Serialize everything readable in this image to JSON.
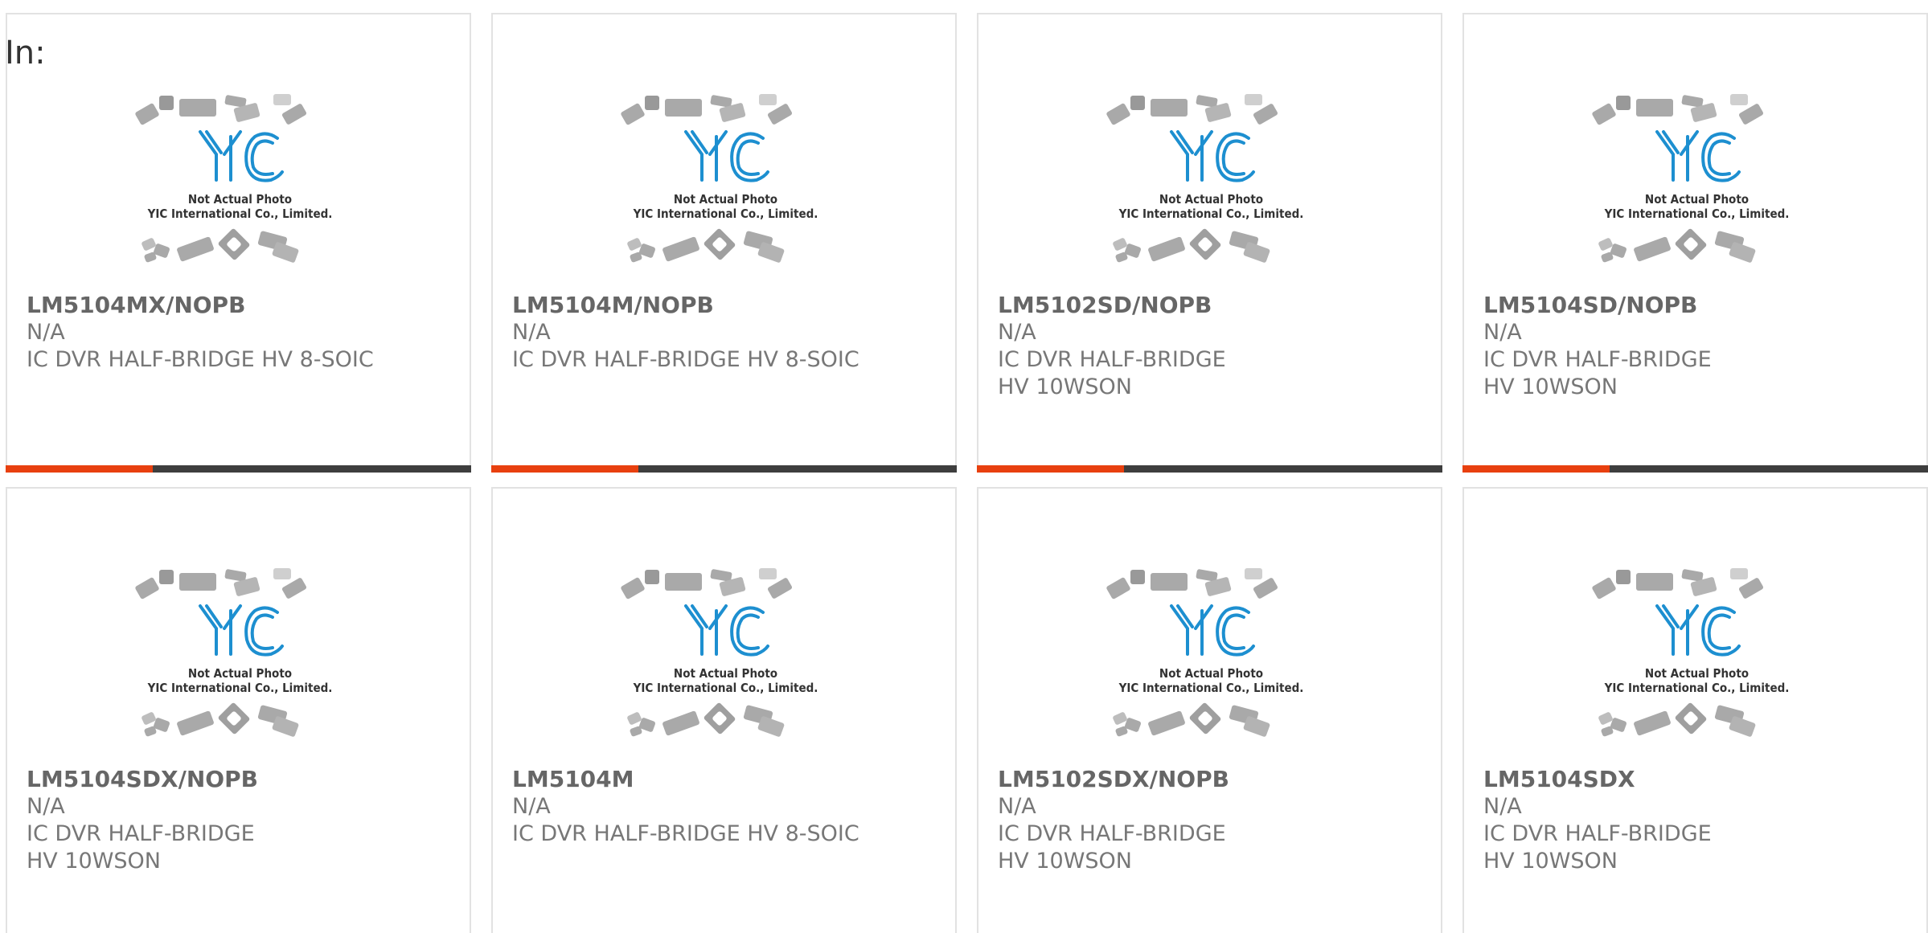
{
  "header": {
    "label": "In:"
  },
  "colors": {
    "accent": "#e8400f",
    "bar": "#3e3e3e",
    "logo": "#1d8fd0"
  },
  "thumbnail": {
    "line1": "Not Actual Photo",
    "line2": "YIC International Co., Limited.",
    "logo_text": "YIC"
  },
  "products": [
    {
      "part": "LM5104MX/NOPB",
      "manufacturer": "N/A",
      "description": "IC DVR HALF-BRIDGE HV 8-SOIC"
    },
    {
      "part": "LM5104M/NOPB",
      "manufacturer": "N/A",
      "description": "IC DVR HALF-BRIDGE HV 8-SOIC"
    },
    {
      "part": "LM5102SD/NOPB",
      "manufacturer": "N/A",
      "description": "IC DVR HALF-BRIDGE HV 10WSON"
    },
    {
      "part": "LM5104SD/NOPB",
      "manufacturer": "N/A",
      "description": "IC DVR HALF-BRIDGE HV 10WSON"
    },
    {
      "part": "LM5104SDX/NOPB",
      "manufacturer": "N/A",
      "description": "IC DVR HALF-BRIDGE HV 10WSON"
    },
    {
      "part": "LM5104M",
      "manufacturer": "N/A",
      "description": "IC DVR HALF-BRIDGE HV 8-SOIC"
    },
    {
      "part": "LM5102SDX/NOPB",
      "manufacturer": "N/A",
      "description": "IC DVR HALF-BRIDGE HV 10WSON"
    },
    {
      "part": "LM5104SDX",
      "manufacturer": "N/A",
      "description": "IC DVR HALF-BRIDGE HV 10WSON"
    }
  ]
}
